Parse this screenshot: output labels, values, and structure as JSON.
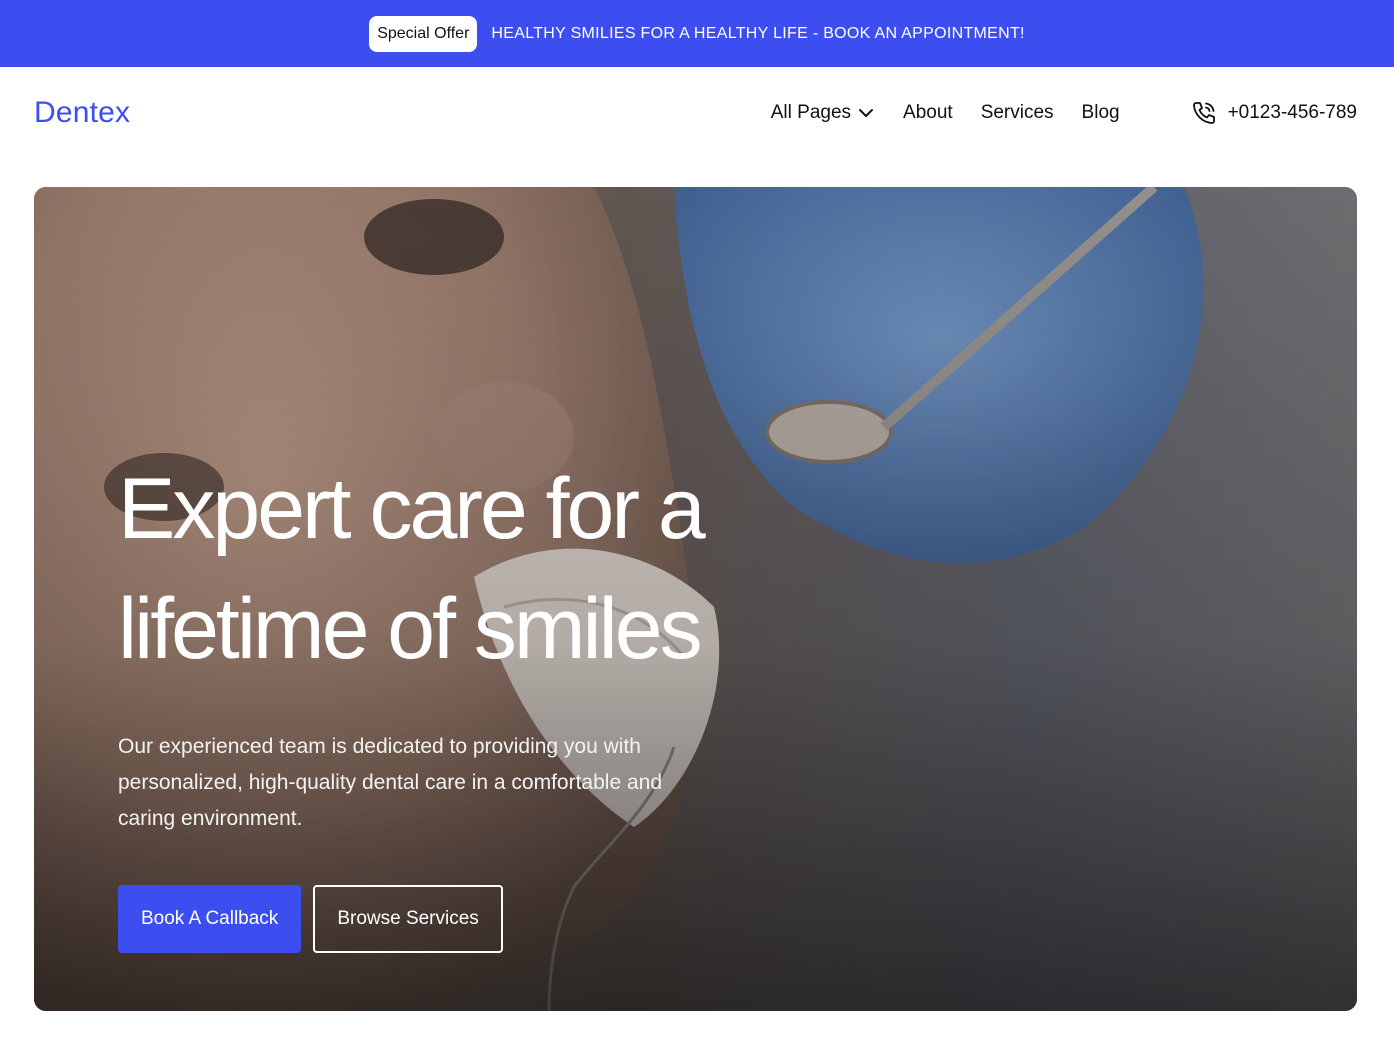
{
  "announcement": {
    "badge": "Special Offer",
    "text": "HEALTHY SMILIES FOR A HEALTHY LIFE -  BOOK AN APPOINTMENT!"
  },
  "header": {
    "logo": "Dentex",
    "nav": {
      "all_pages": "All Pages",
      "about": "About",
      "services": "Services",
      "blog": "Blog"
    },
    "phone": "+0123-456-789"
  },
  "hero": {
    "title_line1": "Expert care for a",
    "title_line2": "lifetime of smiles",
    "subtitle": "Our experienced team is dedicated to providing you with personalized, high-quality dental care in a comfortable and caring environment.",
    "primary_button": "Book A Callback",
    "secondary_button": "Browse Services"
  },
  "colors": {
    "accent": "#3d4ef0",
    "text": "#111111",
    "white": "#ffffff"
  },
  "icons": {
    "chevron": "chevron-down-icon",
    "phone": "phone-icon"
  }
}
